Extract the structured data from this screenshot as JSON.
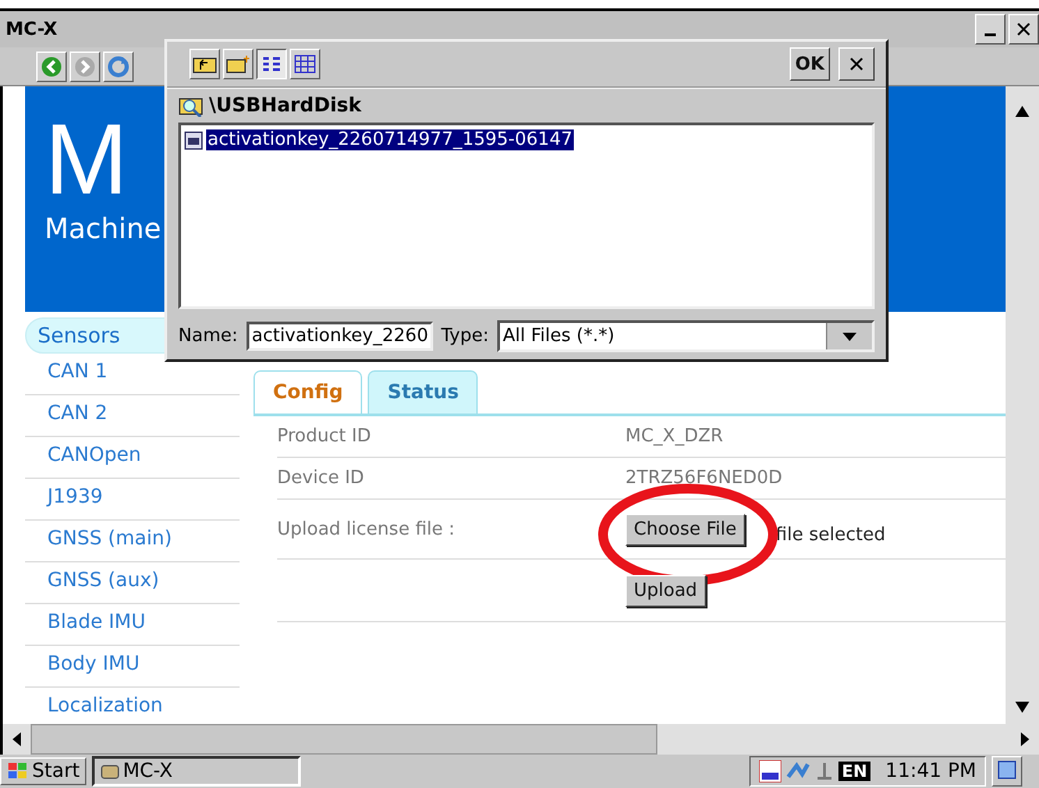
{
  "window": {
    "title": "MC-X"
  },
  "banner": {
    "title": "M",
    "subtitle": "Machine"
  },
  "sidebar": {
    "heading": "Sensors",
    "items": [
      "CAN 1",
      "CAN 2",
      "CANOpen",
      "J1939",
      "GNSS (main)",
      "GNSS (aux)",
      "Blade IMU",
      "Body IMU",
      "Localization"
    ]
  },
  "tabs": [
    {
      "label": "Config",
      "selected": true
    },
    {
      "label": "Status",
      "selected": false
    }
  ],
  "rows": [
    {
      "label": "Product ID",
      "value": "MC_X_DZR"
    },
    {
      "label": "Device ID",
      "value": "2TRZ56F6NED0D"
    }
  ],
  "upload": {
    "label": "Upload license file :",
    "choose_button": "Choose File",
    "status": "file selected",
    "upload_button": "Upload",
    "highlighted": true
  },
  "dialog": {
    "ok": "OK",
    "path": "\\USBHardDisk",
    "files": [
      {
        "name": "activationkey_2260714977_1595-06147",
        "selected": true
      }
    ],
    "name_label": "Name:",
    "name_value": "activationkey_2260",
    "type_label": "Type:",
    "type_value": "All Files (*.*)"
  },
  "taskbar": {
    "start": "Start",
    "task": "MC-X",
    "language": "EN",
    "time": "11:41 PM"
  }
}
